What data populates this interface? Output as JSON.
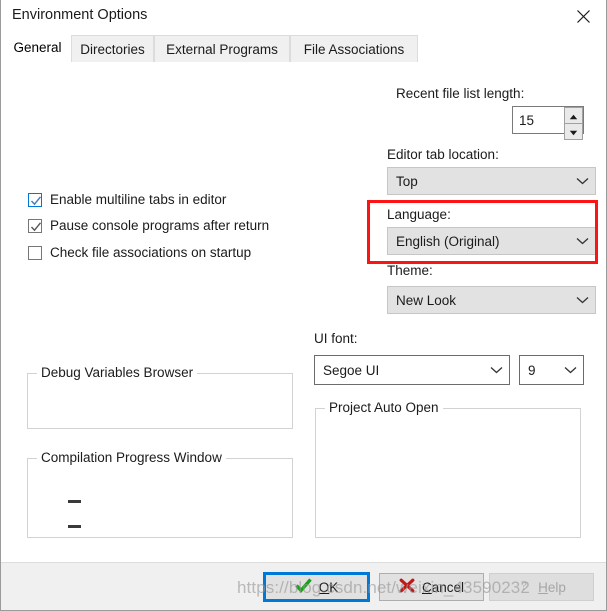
{
  "window": {
    "title": "Environment Options",
    "close_icon": "close-icon"
  },
  "tabs": [
    {
      "label": "General",
      "active": true
    },
    {
      "label": "Directories",
      "active": false
    },
    {
      "label": "External Programs",
      "active": false
    },
    {
      "label": "File Associations",
      "active": false
    }
  ],
  "general": {
    "checkboxes": [
      {
        "label": "Enable multiline tabs in editor",
        "checked": true,
        "focused": true
      },
      {
        "label": "Pause console programs after return",
        "checked": true,
        "focused": false
      },
      {
        "label": "Check file associations on startup",
        "checked": false,
        "focused": false
      }
    ],
    "recent_file_list": {
      "label": "Recent file list length:",
      "value": "15",
      "up_icon": "spinner-up-icon",
      "down_icon": "spinner-down-icon"
    },
    "editor_tab_location": {
      "label": "Editor tab location:",
      "value": "Top",
      "arrow_icon": "chevron-down-icon"
    },
    "language": {
      "label": "Language:",
      "value": "English (Original)",
      "arrow_icon": "chevron-down-icon"
    },
    "theme": {
      "label": "Theme:",
      "value": "New Look",
      "arrow_icon": "chevron-down-icon"
    },
    "ui_font": {
      "label": "UI font:",
      "family_value": "Segoe UI",
      "size_value": "9",
      "arrow_icon": "chevron-down-icon"
    },
    "groups": {
      "debug_variables_browser": "Debug Variables Browser",
      "compilation_progress_window": "Compilation Progress Window",
      "project_auto_open": "Project Auto Open"
    }
  },
  "highlight": {
    "color": "#fb1414"
  },
  "footer": {
    "ok": {
      "label_pre": "",
      "label_accel": "O",
      "label_post": "K",
      "icon": "green-check-icon"
    },
    "cancel": {
      "label_pre": "",
      "label_accel": "C",
      "label_post": "ancel",
      "icon": "red-x-icon"
    },
    "help": {
      "label_pre": "",
      "label_accel": "H",
      "label_post": "elp",
      "icon": "question-mark-icon",
      "disabled": true
    }
  },
  "watermark": {
    "text": "https://blog.csdn.net/weixin_43590232"
  }
}
